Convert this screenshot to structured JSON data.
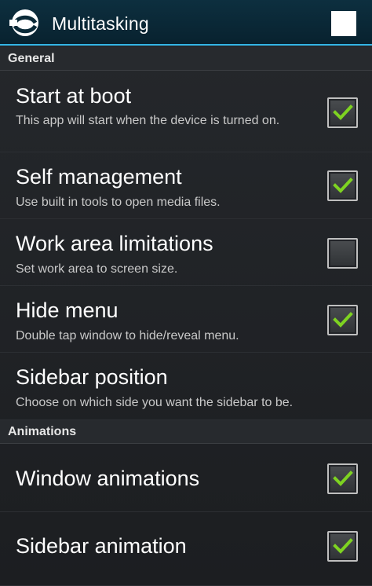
{
  "action_bar": {
    "title": "Multitasking",
    "icon": "multitasking-app-icon",
    "overflow_icon": "white-square-icon"
  },
  "sections": {
    "general": {
      "label": "General"
    },
    "animations": {
      "label": "Animations"
    }
  },
  "preferences": {
    "start_at_boot": {
      "title": "Start at boot",
      "summary": "This app will start when the device is turned on.",
      "checked": true
    },
    "self_management": {
      "title": "Self management",
      "summary": "Use built in tools to open media files.",
      "checked": true
    },
    "work_area_limitations": {
      "title": "Work area limitations",
      "summary": "Set work area to screen size.",
      "checked": false
    },
    "hide_menu": {
      "title": "Hide menu",
      "summary": "Double tap window to hide/reveal menu.",
      "checked": true
    },
    "sidebar_position": {
      "title": "Sidebar position",
      "summary": "Choose on which side you want the sidebar to be."
    },
    "window_animations": {
      "title": "Window animations",
      "checked": true
    },
    "sidebar_animation": {
      "title": "Sidebar animation",
      "checked": true
    }
  },
  "colors": {
    "accent": "#33b5e5",
    "check": "#7ed321",
    "action_bar": "#0d2f3f"
  }
}
